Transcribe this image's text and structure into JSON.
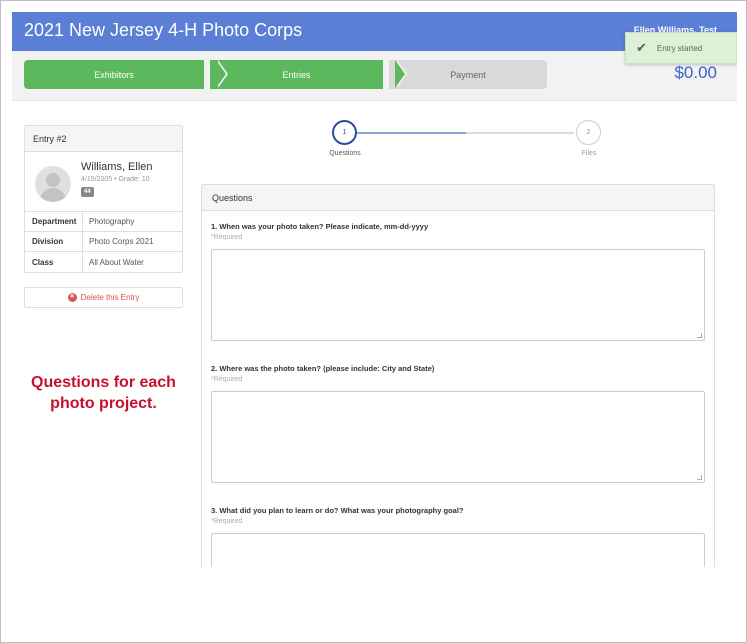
{
  "header": {
    "title": "2021 New Jersey 4-H Photo Corps",
    "user": "Ellen Williams, Test"
  },
  "toast": {
    "message": "Entry started"
  },
  "steps": [
    "Exhibitors",
    "Entries",
    "Payment"
  ],
  "total": "$0.00",
  "entry_card": {
    "title": "Entry #2",
    "name": "Williams, Ellen",
    "meta": "4/15/2005 • Grade: 10",
    "badge": "44",
    "rows": [
      {
        "key": "Department",
        "value": "Photography"
      },
      {
        "key": "Division",
        "value": "Photo Corps 2021"
      },
      {
        "key": "Class",
        "value": "All About Water"
      }
    ]
  },
  "delete_label": "Delete this Entry",
  "annotation": "Questions for each photo project.",
  "progress": {
    "steps": [
      {
        "num": "1",
        "label": "Questions"
      },
      {
        "num": "2",
        "label": "Files"
      }
    ]
  },
  "questions_panel": {
    "title": "Questions",
    "required_label": "*Required",
    "items": [
      {
        "text": "1. When was your photo taken? Please indicate, mm-dd-yyyy"
      },
      {
        "text": "2. Where was the photo taken? (please include: City and State)"
      },
      {
        "text": "3. What did you plan to learn or do? What was your photography goal?"
      }
    ]
  },
  "colors": {
    "header": "#5a7fd4",
    "step_done": "#5cb85c",
    "step_todo": "#d9d9d9",
    "total": "#3a62c9",
    "annotation": "#c8102e",
    "delete": "#d9534f"
  }
}
